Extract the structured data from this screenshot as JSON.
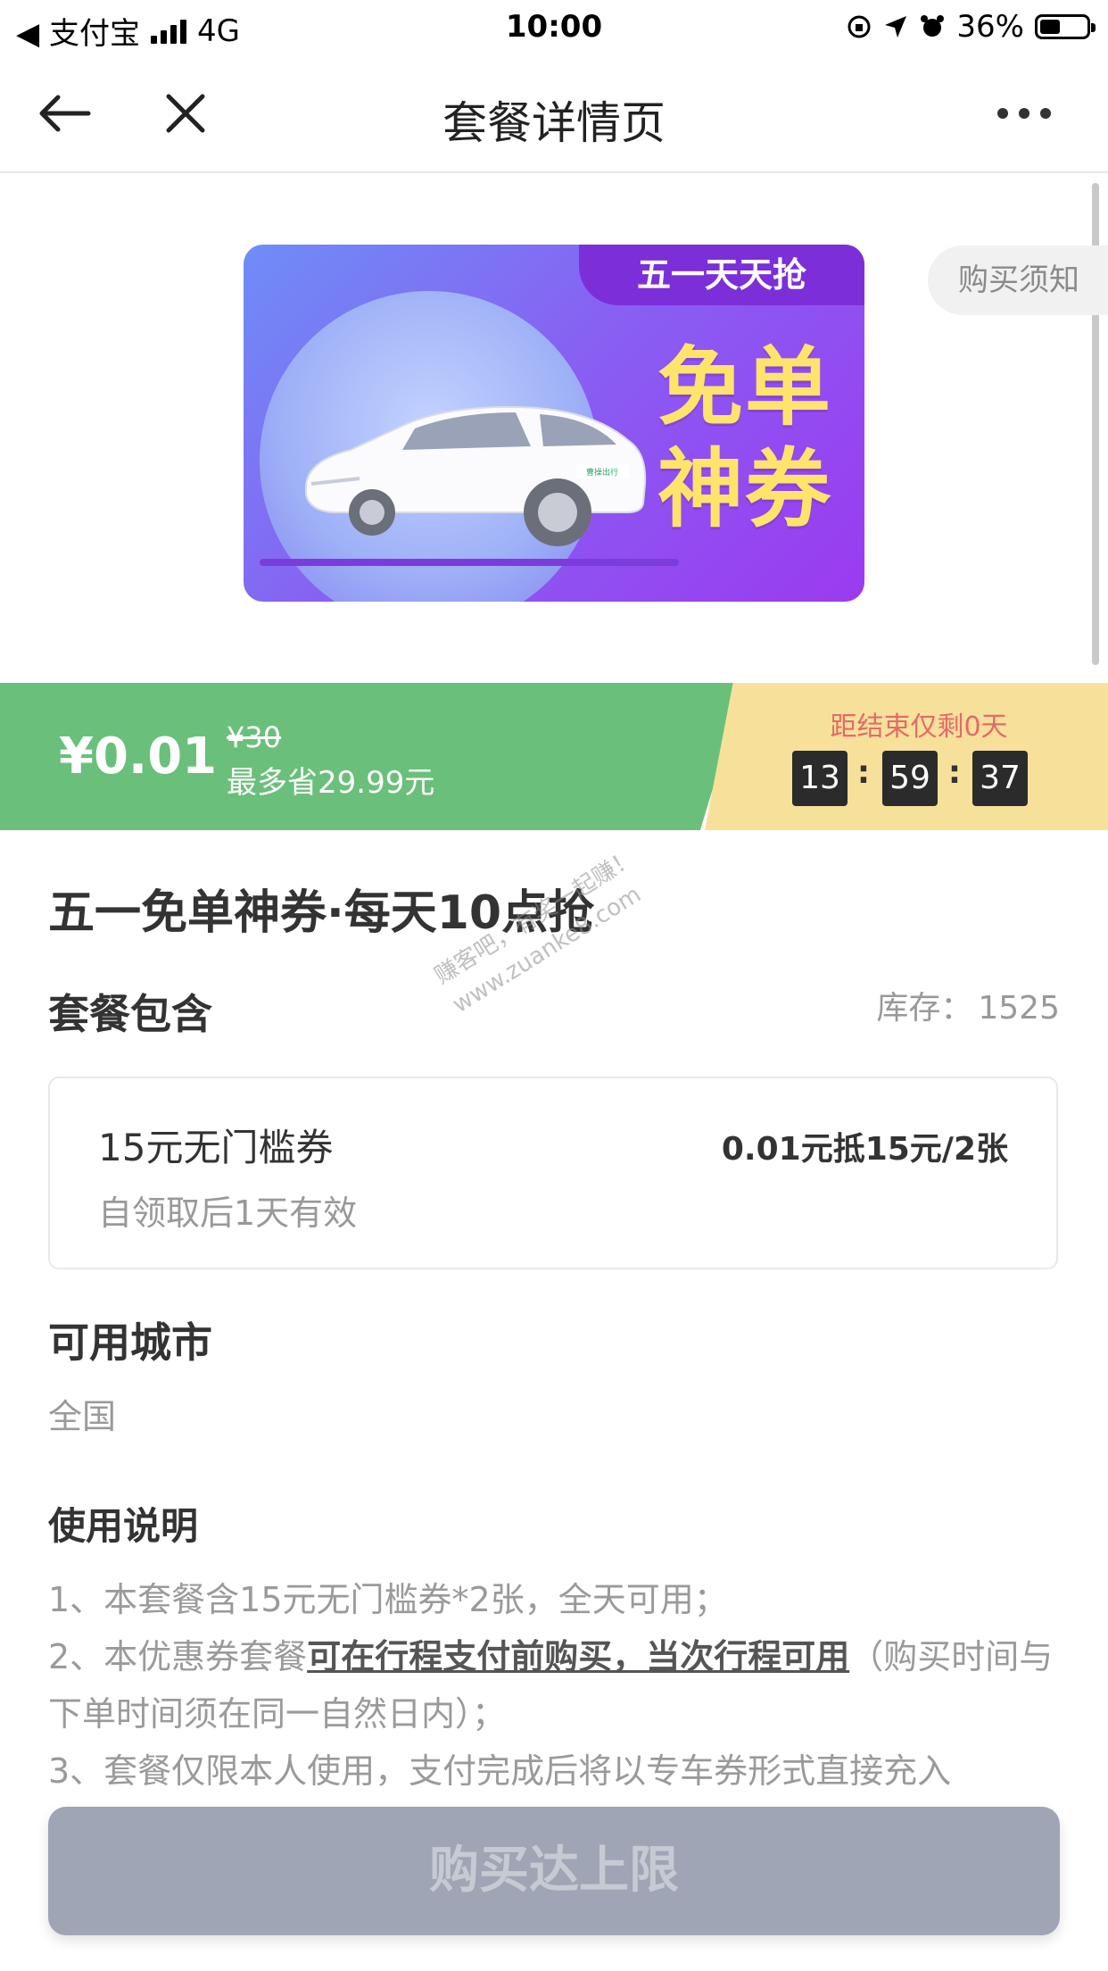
{
  "status_bar": {
    "back_app": "◀ 支付宝",
    "network": "4G",
    "time": "10:00",
    "battery": "36%"
  },
  "nav": {
    "title": "套餐详情页"
  },
  "banner": {
    "ribbon": "五一天天抢",
    "line1": "免单",
    "line2": "神券",
    "car_logo": "曹操出行",
    "notice_tag": "购买须知"
  },
  "price": {
    "current": "¥0.01",
    "original": "¥30",
    "save": "最多省29.99元",
    "countdown_label": "距结束仅剩0天",
    "hours": "13",
    "minutes": "59",
    "seconds": "37",
    "separator": ":"
  },
  "package": {
    "title": "五一免单神券·每天10点抢",
    "includes_heading": "套餐包含",
    "stock_label": "库存：",
    "stock_value": "1525",
    "coupon": {
      "name": "15元无门槛券",
      "price": "0.01元抵15元/2张",
      "validity": "自领取后1天有效"
    },
    "cities_heading": "可用城市",
    "cities_value": "全国",
    "usage_heading": "使用说明",
    "usage": {
      "line1": "1、本套餐含15元无门槛券*2张，全天可用；",
      "line2_prefix": "2、本优惠券套餐",
      "line2_highlight": "可在行程支付前购买，当次行程可用",
      "line2_suffix": "（购买时间与下单时间须在同一自然日内）；",
      "line3": "3、套餐仅限本人使用，支付完成后将以专车券形式直接充入"
    }
  },
  "buy_button": {
    "label": "购买达上限"
  },
  "watermark": {
    "line1": "赚客吧，有奖一起赚！",
    "line2": "www.zuanke8.com"
  },
  "colors": {
    "green": "#6ac07a",
    "yellow": "#f7e19a",
    "purple": "#8a5cf2",
    "promo_text": "#ffe46b",
    "disabled_button": "#9fa5b5"
  }
}
